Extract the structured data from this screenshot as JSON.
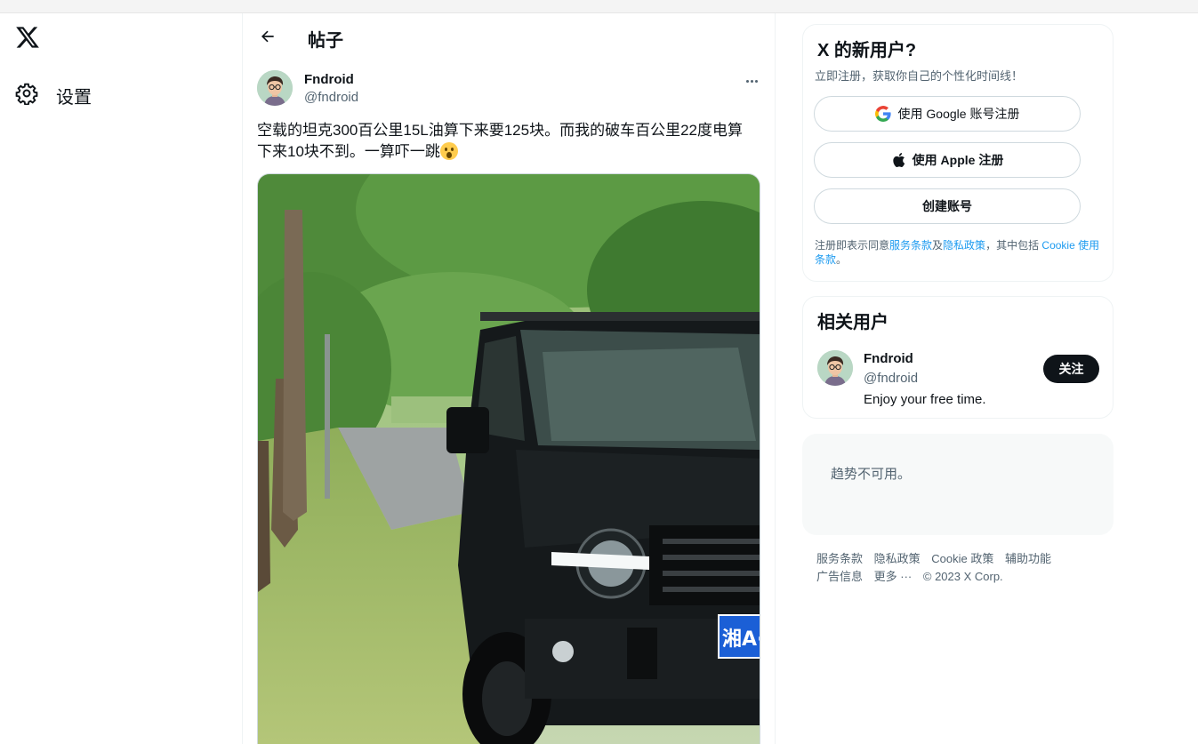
{
  "nav": {
    "settings_label": "设置"
  },
  "header": {
    "title": "帖子"
  },
  "tweet": {
    "author_name": "Fndroid",
    "author_handle": "@fndroid",
    "text": "空载的坦克300百公里15L油算下来要125块。而我的破车百公里22度电算下来10块不到。一算吓一跳",
    "photo_plate_text": "湘A·"
  },
  "signup": {
    "title": "X 的新用户?",
    "subtitle": "立即注册，获取你自己的个性化时间线！",
    "google_label": "使用 Google 账号注册",
    "apple_label": "使用 Apple 注册",
    "create_label": "创建账号",
    "terms_prefix": "注册即表示同意",
    "terms_link": "服务条款",
    "terms_and": "及",
    "privacy_link": "隐私政策",
    "terms_mid": "，其中包括 ",
    "cookie_link": "Cookie 使用条款",
    "terms_end": "。"
  },
  "related": {
    "title": "相关用户",
    "name": "Fndroid",
    "handle": "@fndroid",
    "bio": "Enjoy your free time.",
    "follow_label": "关注"
  },
  "trends": {
    "unavailable": "趋势不可用。"
  },
  "footer": {
    "links": [
      "服务条款",
      "隐私政策",
      "Cookie 政策",
      "辅助功能",
      "广告信息",
      "更多 ···"
    ],
    "copyright": "© 2023 X Corp."
  },
  "colors": {
    "link": "#1d9bf0",
    "text": "#0f1419",
    "muted": "#536471"
  }
}
